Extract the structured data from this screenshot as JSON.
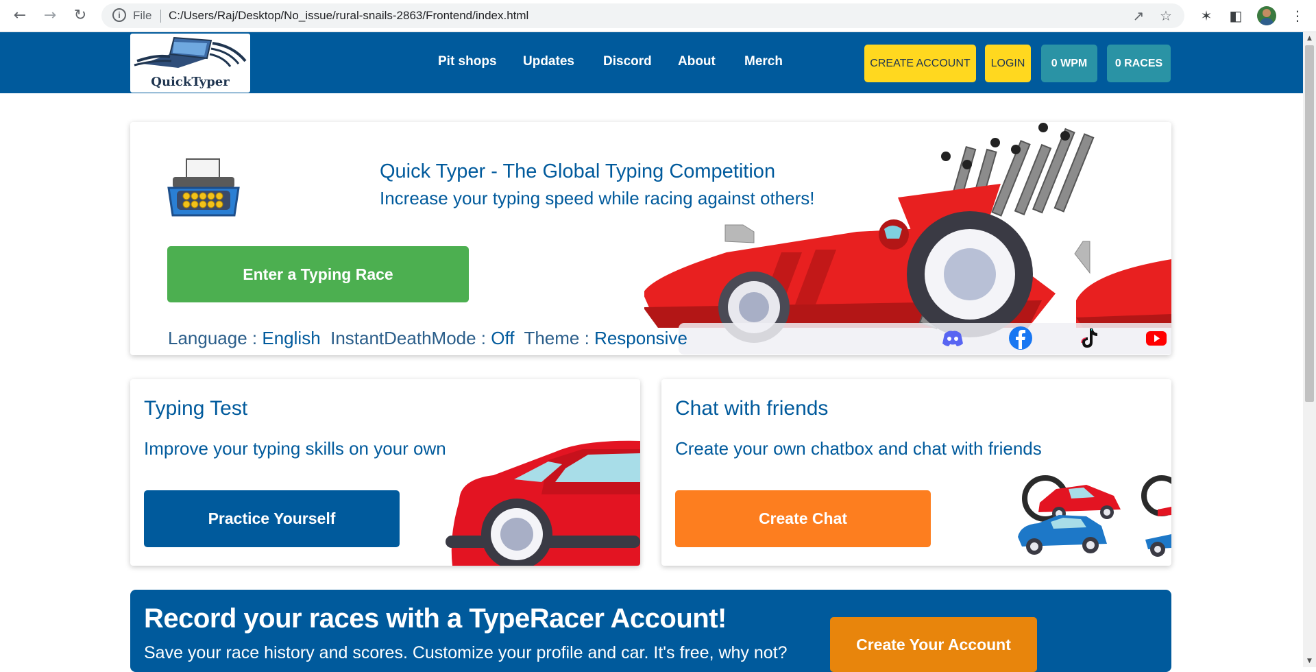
{
  "browser": {
    "back_icon": "arrow-left-icon",
    "forward_icon": "arrow-right-icon",
    "reload_icon": "reload-icon",
    "scheme_label": "File",
    "url": "C:/Users/Raj/Desktop/No_issue/rural-snails-2863/Frontend/index.html"
  },
  "header": {
    "logo_text": "QuickTyper",
    "nav": [
      "Pit shops",
      "Updates",
      "Discord",
      "About",
      "Merch"
    ],
    "create_account": "CREATE ACCOUNT",
    "login": "LOGIN",
    "wpm": "0 WPM",
    "races": "0 RACES"
  },
  "hero": {
    "title": "Quick Typer - The Global Typing Competition",
    "subtitle": "Increase your typing speed while racing against others!",
    "cta": "Enter a Typing Race",
    "settings": {
      "language_label": "Language :",
      "language_value": "English",
      "mode_label": "InstantDeathMode :",
      "mode_value": "Off",
      "theme_label": "Theme :",
      "theme_value": "Responsive"
    }
  },
  "typing_test": {
    "title": "Typing Test",
    "subtitle": "Improve your typing skills on your own",
    "button": "Practice Yourself"
  },
  "chat": {
    "title": "Chat with friends",
    "subtitle": "Create your own chatbox and chat with friends",
    "button": "Create Chat"
  },
  "banner": {
    "title": "Record your races with a TypeRacer Account!",
    "subtitle": "Save your race history and scores. Customize your profile and car. It's free, why not?",
    "button": "Create Your Account"
  },
  "colors": {
    "brand_blue": "#005a9c",
    "yellow": "#ffd81f",
    "teal": "#2a93a5",
    "green": "#4caf50",
    "orange": "#fd7e1f",
    "banner_orange": "#e8850c"
  }
}
